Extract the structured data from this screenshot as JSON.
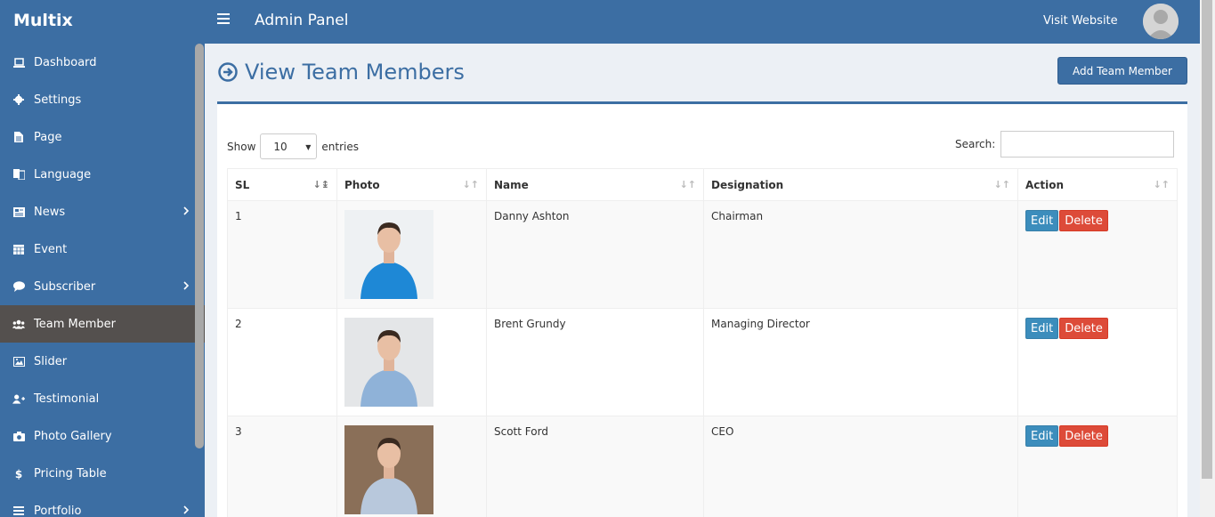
{
  "brand": "Multix",
  "header": {
    "title": "Admin Panel",
    "visit_link": "Visit Website"
  },
  "sidebar": {
    "items": [
      {
        "label": "Dashboard",
        "icon": "laptop-icon",
        "has_submenu": false,
        "active": false
      },
      {
        "label": "Settings",
        "icon": "gear-icon",
        "has_submenu": false,
        "active": false
      },
      {
        "label": "Page",
        "icon": "file-icon",
        "has_submenu": false,
        "active": false
      },
      {
        "label": "Language",
        "icon": "language-icon",
        "has_submenu": false,
        "active": false
      },
      {
        "label": "News",
        "icon": "newspaper-icon",
        "has_submenu": true,
        "active": false
      },
      {
        "label": "Event",
        "icon": "calendar-icon",
        "has_submenu": false,
        "active": false
      },
      {
        "label": "Subscriber",
        "icon": "comment-icon",
        "has_submenu": true,
        "active": false
      },
      {
        "label": "Team Member",
        "icon": "users-icon",
        "has_submenu": false,
        "active": true
      },
      {
        "label": "Slider",
        "icon": "image-icon",
        "has_submenu": false,
        "active": false
      },
      {
        "label": "Testimonial",
        "icon": "user-plus-icon",
        "has_submenu": false,
        "active": false
      },
      {
        "label": "Photo Gallery",
        "icon": "camera-icon",
        "has_submenu": false,
        "active": false
      },
      {
        "label": "Pricing Table",
        "icon": "dollar-icon",
        "has_submenu": false,
        "active": false
      },
      {
        "label": "Portfolio",
        "icon": "list-icon",
        "has_submenu": true,
        "active": false
      }
    ]
  },
  "main": {
    "heading": "View Team Members",
    "add_button": "Add Team Member",
    "show_label": "Show",
    "entries_value": "10",
    "entries_label": "entries",
    "search_label": "Search:",
    "search_value": ""
  },
  "table": {
    "columns": [
      "SL",
      "Photo",
      "Name",
      "Designation",
      "Action"
    ],
    "rows": [
      {
        "sl": "1",
        "name": "Danny Ashton",
        "designation": "Chairman",
        "shirt": "#1e88d6",
        "bg": "#eef1f3"
      },
      {
        "sl": "2",
        "name": "Brent Grundy",
        "designation": "Managing Director",
        "shirt": "#8fb2d8",
        "bg": "#e4e6e8"
      },
      {
        "sl": "3",
        "name": "Scott Ford",
        "designation": "CEO",
        "shirt": "#b8c8dc",
        "bg": "#8a6f58"
      }
    ],
    "edit_label": "Edit",
    "delete_label": "Delete"
  },
  "colors": {
    "primary": "#3c6ea3",
    "active_item": "#54504e",
    "edit": "#3c8dbc",
    "delete": "#dd4b39"
  }
}
